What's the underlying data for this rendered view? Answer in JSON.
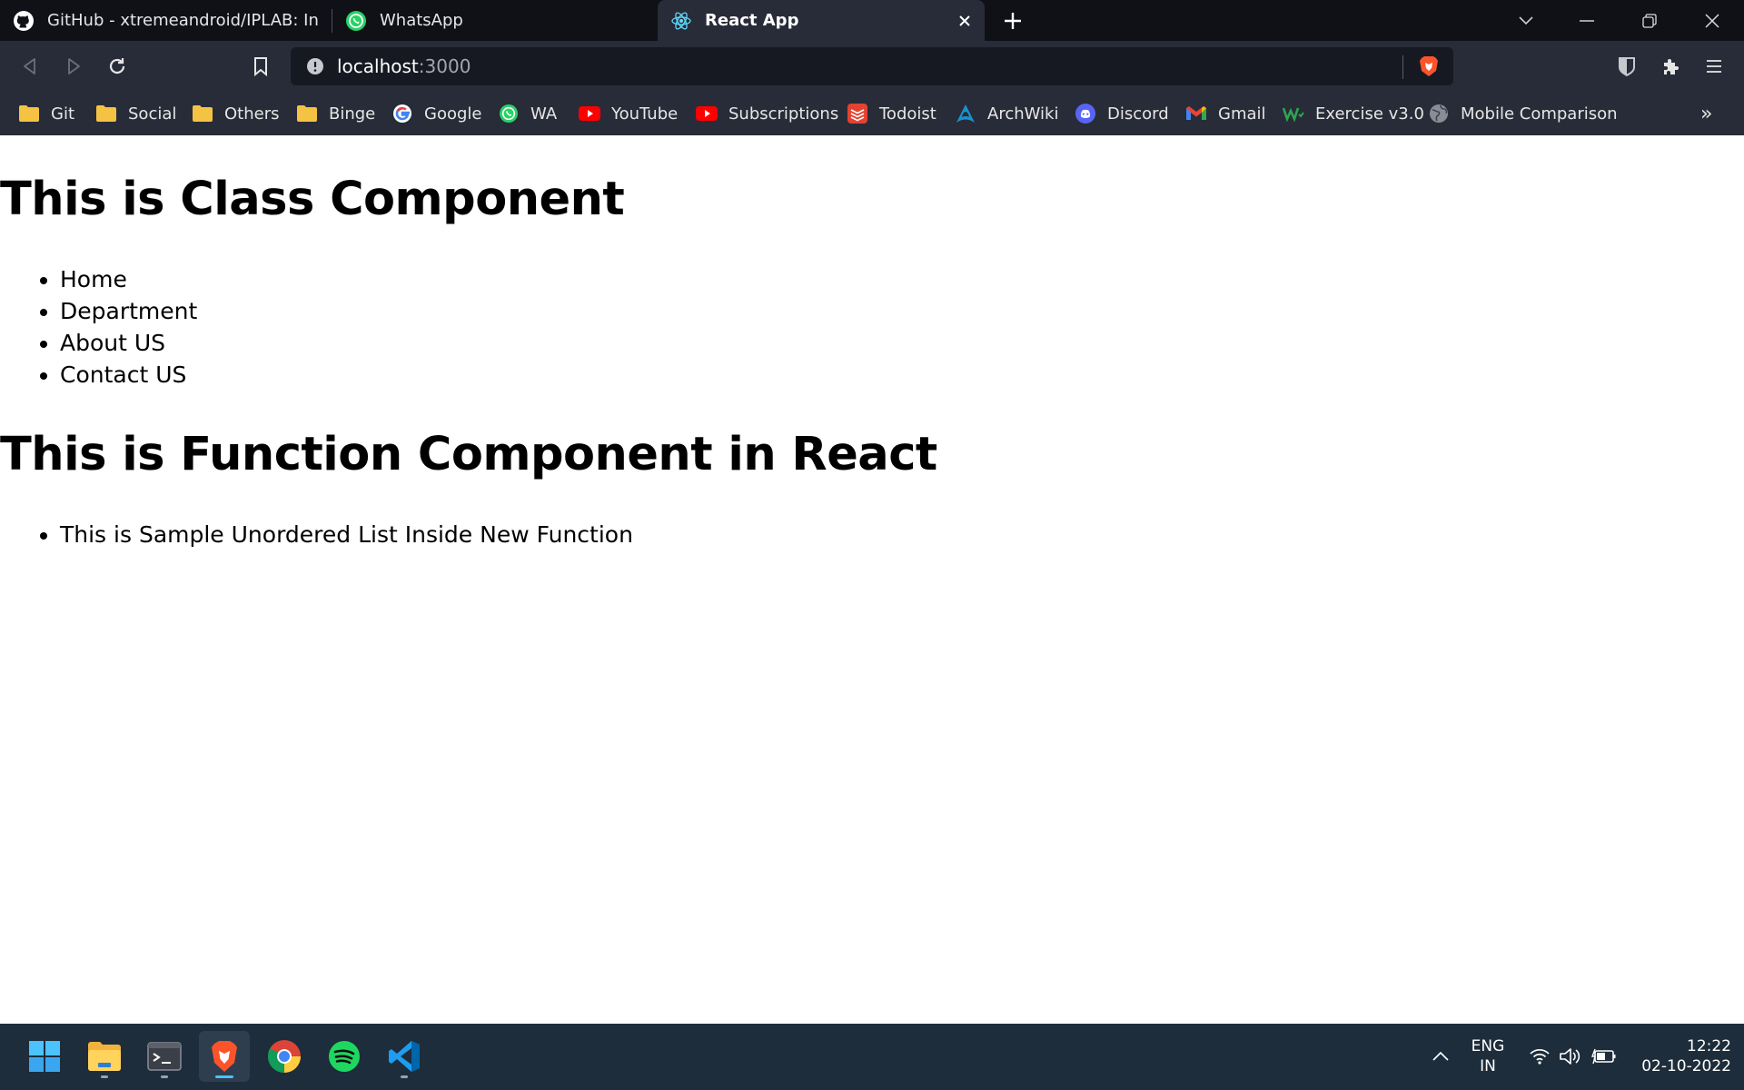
{
  "browser": {
    "tabs": [
      {
        "label": "GitHub - xtremeandroid/IPLAB: Interne",
        "icon": "github-icon",
        "active": false
      },
      {
        "label": "WhatsApp",
        "icon": "whatsapp-icon",
        "active": false
      },
      {
        "label": "React App",
        "icon": "react-icon",
        "active": true
      }
    ],
    "address": {
      "host": "localhost",
      "port": ":3000"
    },
    "bookmarks": [
      {
        "label": "Git",
        "icon": "folder-icon"
      },
      {
        "label": "Social",
        "icon": "folder-icon"
      },
      {
        "label": "Others",
        "icon": "folder-icon"
      },
      {
        "label": "Binge",
        "icon": "folder-icon"
      },
      {
        "label": "Google",
        "icon": "google-icon"
      },
      {
        "label": "WA",
        "icon": "whatsapp-icon"
      },
      {
        "label": "YouTube",
        "icon": "youtube-icon"
      },
      {
        "label": "Subscriptions",
        "icon": "youtube-icon"
      },
      {
        "label": "Todoist",
        "icon": "todoist-icon"
      },
      {
        "label": "ArchWiki",
        "icon": "archwiki-icon"
      },
      {
        "label": "Discord",
        "icon": "discord-icon"
      },
      {
        "label": "Gmail",
        "icon": "gmail-icon"
      },
      {
        "label": "Exercise v3.0",
        "icon": "exercise-icon"
      },
      {
        "label": "Mobile Comparison",
        "icon": "globe-icon"
      }
    ],
    "bookmarks_overflow": "»",
    "colors": {
      "chrome_bg": "#282c38",
      "tabstrip_bg": "#0f1117",
      "brave_orange": "#fb542b"
    }
  },
  "page": {
    "class_heading": "This is Class Component",
    "class_items": [
      "Home",
      "Department",
      "About US",
      "Contact US"
    ],
    "function_heading": "This is Function Component in React",
    "function_items": [
      "This is Sample Unordered List Inside New Function"
    ]
  },
  "taskbar": {
    "apps": [
      "windows-start-icon",
      "file-explorer-icon",
      "terminal-icon",
      "brave-icon",
      "chrome-icon",
      "spotify-icon",
      "vscode-icon"
    ],
    "active_app": "brave-icon",
    "language": {
      "line1": "ENG",
      "line2": "IN"
    },
    "time": "12:22",
    "date": "02-10-2022"
  }
}
